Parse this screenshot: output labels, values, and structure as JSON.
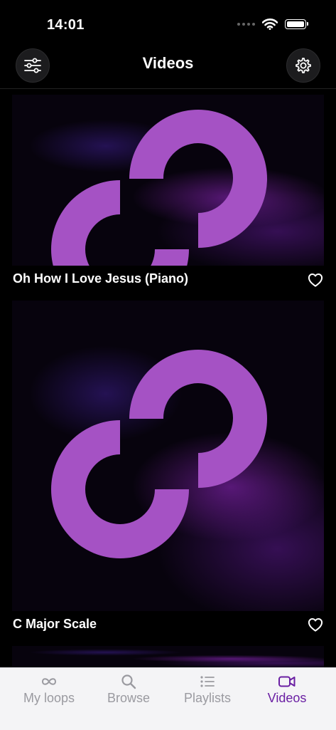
{
  "status_bar": {
    "time": "14:01"
  },
  "nav": {
    "title": "Videos"
  },
  "videos": [
    {
      "title": "Oh How I Love Jesus (Piano)",
      "liked": false
    },
    {
      "title": "C Major Scale",
      "liked": false
    }
  ],
  "tabs": [
    {
      "label": "My loops",
      "icon": "infinity-icon",
      "active": false
    },
    {
      "label": "Browse",
      "icon": "search-icon",
      "active": false
    },
    {
      "label": "Playlists",
      "icon": "list-icon",
      "active": false
    },
    {
      "label": "Videos",
      "icon": "video-camera-icon",
      "active": true
    }
  ],
  "colors": {
    "accent": "#6a1fa3",
    "logo": "#a552c4",
    "tab_inactive": "#9a9aa0"
  }
}
